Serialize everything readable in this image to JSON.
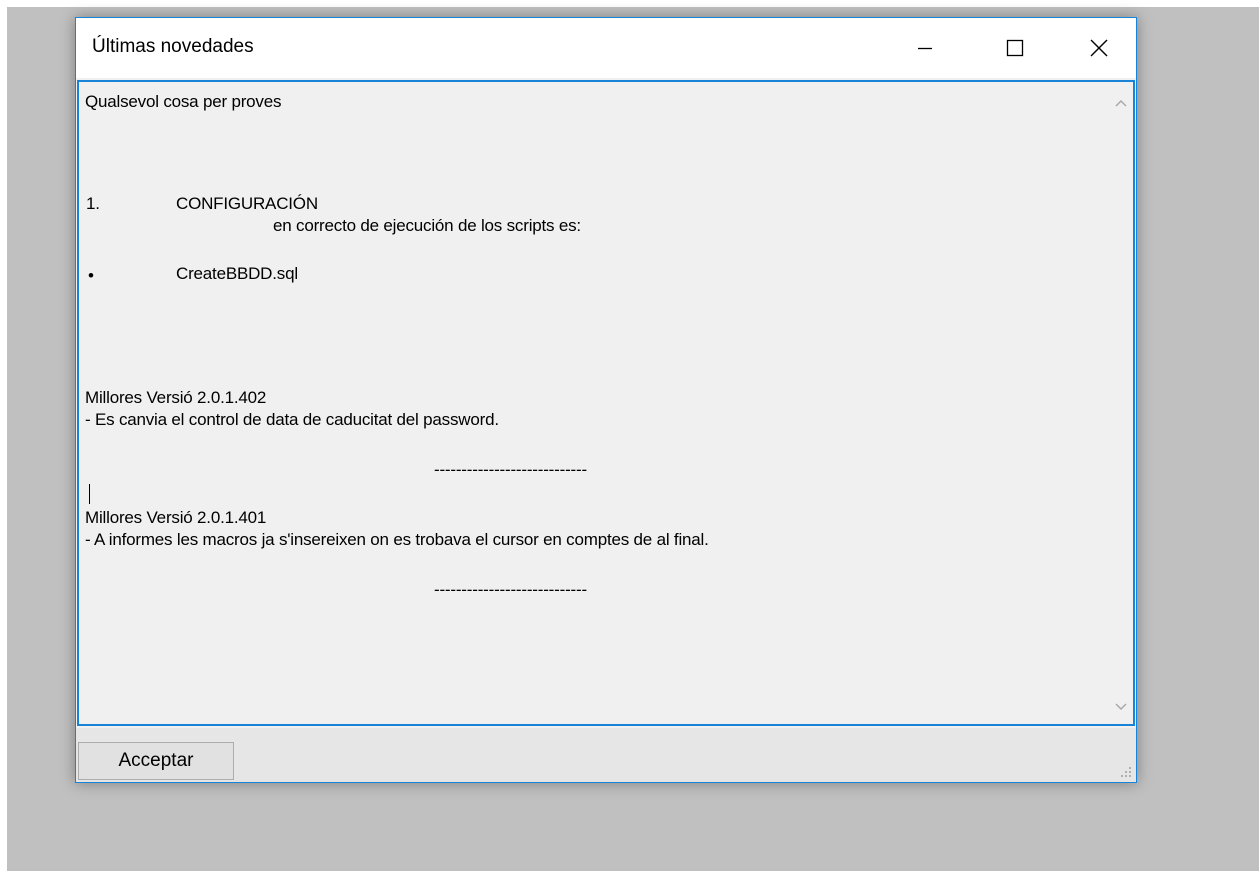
{
  "window": {
    "title": "Últimas novedades"
  },
  "content": {
    "lines": [
      "Qualsevol cosa per proves",
      "1.",
      "CONFIGURACIÓN",
      "en correcto de ejecución de los scripts es:",
      "•",
      "CreateBBDD.sql",
      "Millores Versió 2.0.1.402",
      "- Es canvia el control de data de caducitat del password.",
      "----------------------------",
      "Millores Versió 2.0.1.401",
      "- A informes les macros ja s'insereixen on es trobava el cursor en comptes de al final.",
      "----------------------------"
    ]
  },
  "footer": {
    "accept_label": "Acceptar"
  },
  "icons": {
    "minimize": "minimize-icon",
    "maximize": "maximize-icon",
    "close": "close-icon",
    "scroll_up": "chevron-up-icon",
    "scroll_down": "chevron-down-icon",
    "resize_grip": "resize-grip-icon"
  },
  "colors": {
    "window_border": "#1883d7",
    "desktop": "#c0c0c0",
    "content_bg": "#f0f0f0",
    "titlebar_bg": "#ffffff"
  }
}
